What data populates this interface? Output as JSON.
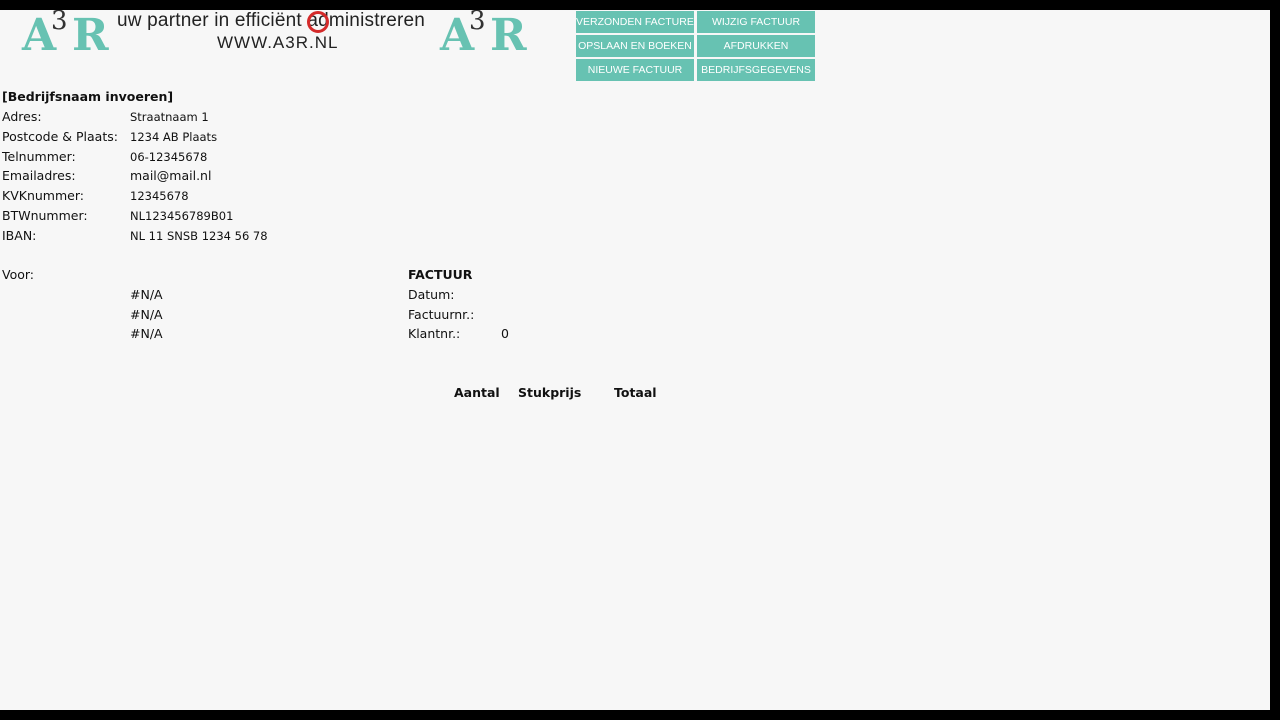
{
  "header": {
    "logo_text": "A3R",
    "tagline": "uw partner in efficiënt administreren",
    "website": "WWW.A3R.NL"
  },
  "buttons": {
    "sent_invoices": "VERZONDEN FACTUREN",
    "edit_invoice": "WIJZIG FACTUUR",
    "save_and_book": "OPSLAAN EN BOEKEN",
    "print": "AFDRUKKEN",
    "new_invoice": "NIEUWE FACTUUR",
    "company_data": "BEDRIJFSGEGEVENS"
  },
  "company": {
    "name": "[Bedrijfsnaam invoeren]",
    "fields": [
      {
        "label": "Adres:",
        "value": "Straatnaam 1"
      },
      {
        "label": "Postcode & Plaats:",
        "value": "1234 AB Plaats"
      },
      {
        "label": "Telnummer:",
        "value": "06-12345678"
      },
      {
        "label": "Emailadres:",
        "value": "mail@mail.nl"
      },
      {
        "label": "KVKnummer:",
        "value": "12345678"
      },
      {
        "label": "BTWnummer:",
        "value": "NL123456789B01"
      },
      {
        "label": "IBAN:",
        "value": "NL 11 SNSB 1234 56 78"
      }
    ]
  },
  "customer": {
    "label": "Voor:",
    "lines": [
      "#N/A",
      "#N/A",
      "#N/A"
    ]
  },
  "invoice": {
    "title": "FACTUUR",
    "date_label": "Datum:",
    "number_label": "Factuurnr.:",
    "client_label": "Klantnr.:",
    "client_value": "0"
  },
  "table": {
    "headers": [
      "Aantal",
      "Stukprijs",
      "Totaal"
    ]
  }
}
